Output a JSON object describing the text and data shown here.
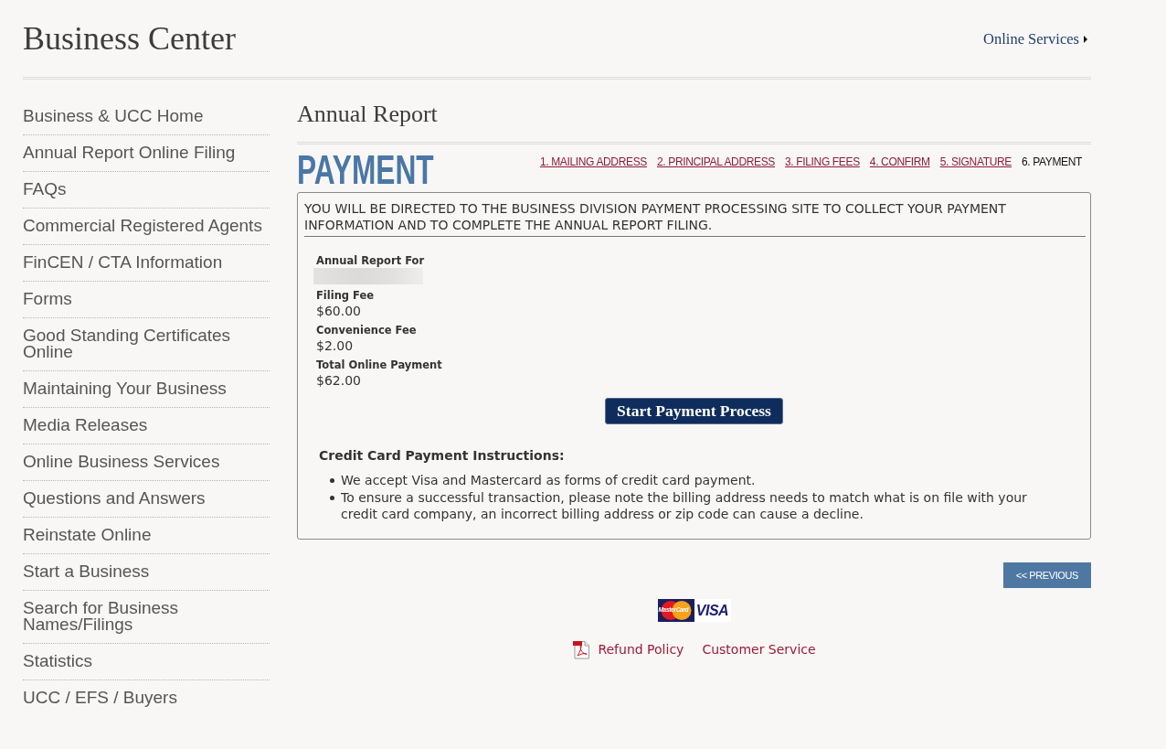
{
  "header": {
    "title": "Business Center",
    "link": "Online Services"
  },
  "sidebar": {
    "items": [
      "Business & UCC Home",
      "Annual Report Online Filing",
      "FAQs",
      "Commercial Registered Agents",
      "FinCEN / CTA Information",
      "Forms",
      "Good Standing Certificates Online",
      "Maintaining Your Business",
      "Media Releases",
      "Online Business Services",
      "Questions and Answers",
      "Reinstate Online",
      "Start a Business",
      "Search for Business Names/Filings",
      "Statistics",
      "UCC / EFS / Buyers"
    ]
  },
  "main": {
    "title": "Annual Report",
    "section_heading": "PAYMENT",
    "steps": [
      {
        "label": "1. MAILING ADDRESS",
        "selected": false
      },
      {
        "label": "2. PRINCIPAL ADDRESS",
        "selected": false
      },
      {
        "label": "3. FILING FEES",
        "selected": false
      },
      {
        "label": "4. CONFIRM",
        "selected": false
      },
      {
        "label": "5. SIGNATURE",
        "selected": false
      },
      {
        "label": "6. PAYMENT",
        "selected": true
      }
    ],
    "notice": "YOU WILL BE DIRECTED TO THE BUSINESS DIVISION PAYMENT PROCESSING SITE TO COLLECT YOUR PAYMENT INFORMATION AND TO COMPLETE THE ANNUAL REPORT FILING.",
    "fields": [
      {
        "label": "Annual Report For",
        "redacted": true
      },
      {
        "label": "Filing Fee",
        "value": "$60.00",
        "redacted": false
      },
      {
        "label": "Convenience Fee",
        "value": "$2.00",
        "redacted": false
      },
      {
        "label": "Total Online Payment",
        "value": "$62.00",
        "redacted": false
      }
    ],
    "start_button": "Start Payment Process",
    "instructions": {
      "heading": "Credit Card Payment Instructions:",
      "items": [
        "We accept Visa and Mastercard as forms of credit card payment.",
        "To ensure a successful transaction, please note the billing address needs to match what is on file with your credit card company, an incorrect billing address or zip code can cause a decline."
      ]
    },
    "previous_button": "<< PREVIOUS",
    "card_logos": [
      {
        "kind": "mastercard",
        "text": "MasterCard"
      },
      {
        "kind": "visa",
        "text": "VISA"
      }
    ],
    "footer_links": [
      {
        "label": "Refund Policy",
        "kind": "pdf"
      },
      {
        "label": "Customer Service",
        "kind": "plain"
      }
    ]
  }
}
